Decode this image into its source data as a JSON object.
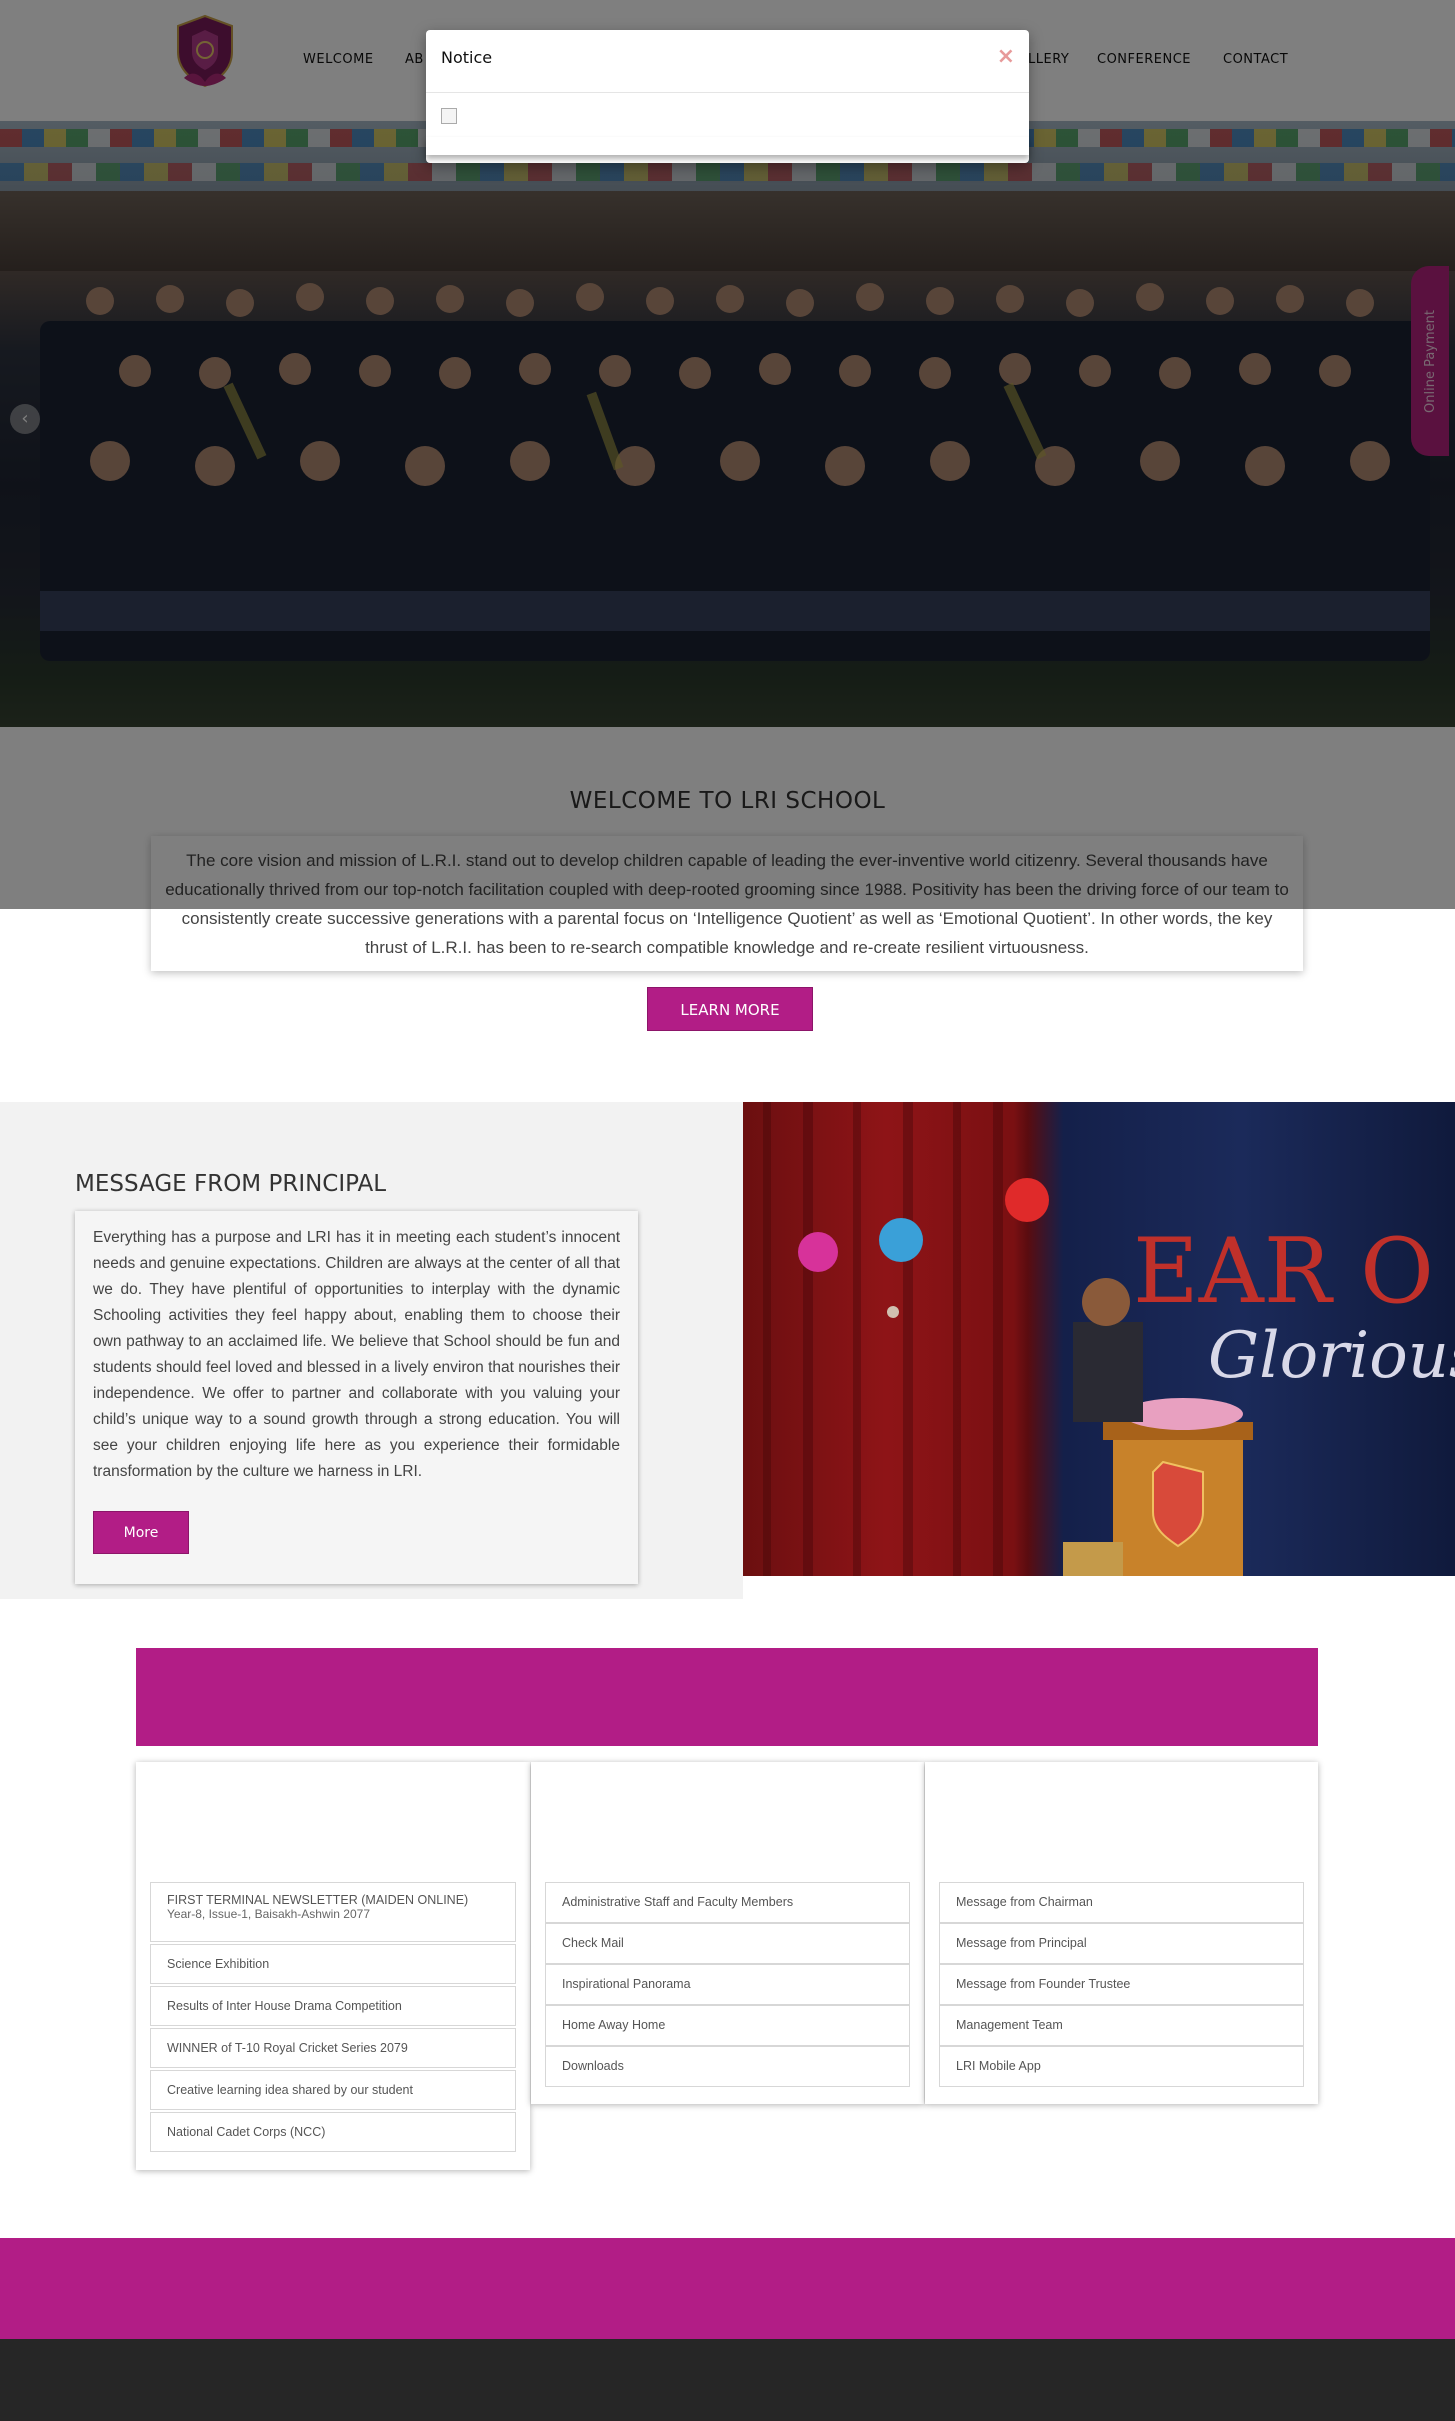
{
  "nav": {
    "items": [
      "WELCOME",
      "AB",
      "LLERY",
      "CONFERENCE",
      "CONTACT"
    ]
  },
  "modal": {
    "title": "Notice",
    "close_icon": "×"
  },
  "hero": {
    "prev_icon": "‹",
    "next_icon": "›",
    "online_payment_label": "Online Payment"
  },
  "welcome": {
    "title": "WELCOME TO LRI SCHOOL",
    "text": "The core vision and mission of L.R.I. stand out to develop children capable of leading the ever-inventive world citizenry. Several thousands have educationally thrived from our top-notch facilitation coupled with deep-rooted grooming since 1988. Positivity has been the driving force of our team to consistently create successive generations with a parental focus on ‘Intelligence Quotient’ as well as ‘Emotional Quotient’. In other words, the key thrust of L.R.I. has been to re-search compatible knowledge and re-create resilient virtuousness.",
    "button_label": "LEARN MORE"
  },
  "principal": {
    "title": "MESSAGE FROM PRINCIPAL",
    "text": "Everything has a purpose and LRI has it in meeting each student’s innocent needs and genuine expectations. Children are always at the center of all that we do. They have plentiful of opportunities to interplay with the dynamic Schooling activities they feel happy about, enabling them to choose their own pathway to an acclaimed life. We believe that School should be fun and students should feel loved and blessed in a lively environ that nourishes their independence. We offer to partner and collaborate with you valuing your child’s unique way to a sound growth through a strong education. You will see your children enjoying life here as you experience their formidable transformation by the culture we harness in LRI.",
    "button_label": "More",
    "photo_banner_text_1": "EAR O",
    "photo_banner_text_2": "Glorious"
  },
  "news": {
    "items": [
      {
        "title": "FIRST TERMINAL NEWSLETTER (MAIDEN ONLINE)",
        "sub": "Year-8, Issue-1, Baisakh-Ashwin 2077"
      },
      {
        "title": "Science Exhibition",
        "sub": ""
      },
      {
        "title": "Results of Inter House Drama Competition",
        "sub": ""
      },
      {
        "title": "WINNER of T-10 Royal Cricket Series 2079",
        "sub": ""
      },
      {
        "title": "Creative learning idea shared by our student",
        "sub": ""
      },
      {
        "title": "National Cadet Corps (NCC)",
        "sub": ""
      }
    ]
  },
  "links_middle": {
    "items": [
      "Administrative Staff and Faculty Members",
      "Check Mail",
      "Inspirational Panorama",
      "Home Away Home",
      "Downloads"
    ]
  },
  "links_right": {
    "items": [
      "Message from Chairman",
      "Message from Principal",
      "Message from Founder Trustee",
      "Management Team",
      "LRI Mobile App"
    ]
  },
  "colors": {
    "brand_purple": "#b21d86",
    "footer_dark": "#262626"
  }
}
